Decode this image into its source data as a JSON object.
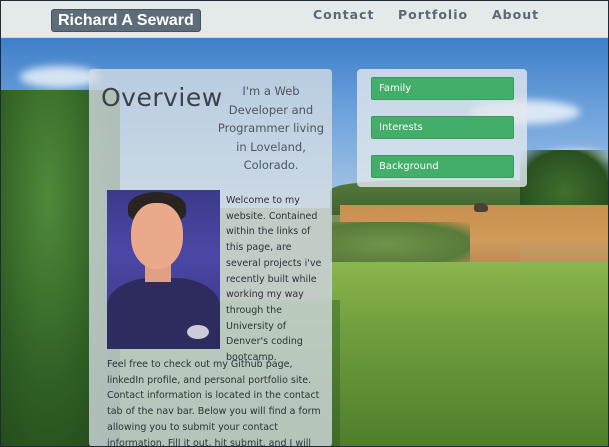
{
  "navbar": {
    "brand": "Richard A Seward",
    "links": [
      {
        "label": "Contact"
      },
      {
        "label": "Portfolio"
      },
      {
        "label": "About"
      }
    ]
  },
  "overview": {
    "title": "Overview",
    "tagline": "I'm a Web Developer and Programmer living in Loveland, Colorado.",
    "intro_top": "Welcome to my website. Contained within the links of this page, are several projects i've recently built while working my way through the University of Denver's coding bootcamp.",
    "intro_bottom": "Feel free to check out my Github page, linkedIn profile, and personal portfolio site. Contact information is located in the contact tab of the nav bar. Below you will find a form allowing you to submit your contact information. Fill it out, hit submit, and I will reach back out to you as soon"
  },
  "menu": {
    "items": [
      {
        "label": "Family"
      },
      {
        "label": "Interests"
      },
      {
        "label": "Background"
      }
    ]
  },
  "colors": {
    "menu_button": "#43ad6a",
    "brand_bg": "#5e6b79",
    "nav_text": "#5b6875"
  }
}
